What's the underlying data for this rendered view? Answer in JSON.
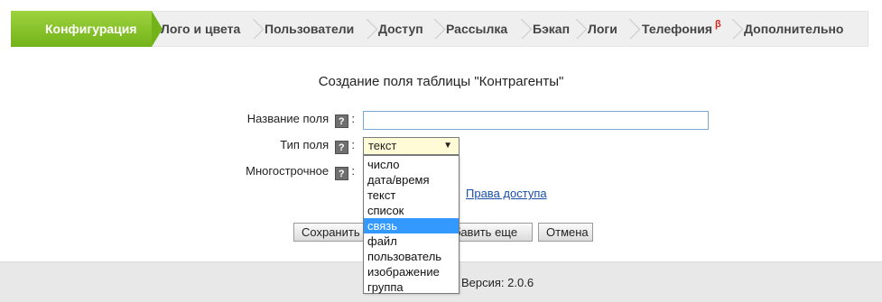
{
  "tabs": [
    {
      "label": "Конфигурация",
      "active": true
    },
    {
      "label": "Лого и цвета"
    },
    {
      "label": "Пользователи"
    },
    {
      "label": "Доступ"
    },
    {
      "label": "Рассылка"
    },
    {
      "label": "Бэкап"
    },
    {
      "label": "Логи"
    },
    {
      "label": "Телефония",
      "badge": "β"
    },
    {
      "label": "Дополнительно"
    }
  ],
  "form": {
    "title": "Создание поля таблицы \"Контрагенты\"",
    "name_label": "Название поля",
    "name_value": "",
    "type_label": "Тип поля",
    "type_value": "текст",
    "multiline_label": "Многострочное",
    "help_glyph": "?",
    "colon": ":",
    "rights_link": "Права доступа"
  },
  "dropdown": {
    "options": [
      "число",
      "дата/время",
      "текст",
      "список",
      "связь",
      "файл",
      "пользователь",
      "изображение",
      "группа"
    ],
    "highlighted": "связь"
  },
  "buttons": {
    "save": "Сохранить",
    "add_more": "Добавить еще",
    "cancel": "Отмена"
  },
  "footer": {
    "version": "Версия: 2.0.6"
  },
  "colors": {
    "active_tab": "#8cc63f",
    "tab_bar": "#efefef",
    "highlight": "#3399ff",
    "select_bg": "#fffbd6",
    "link": "#1a4faa",
    "beta": "#d9261c"
  }
}
